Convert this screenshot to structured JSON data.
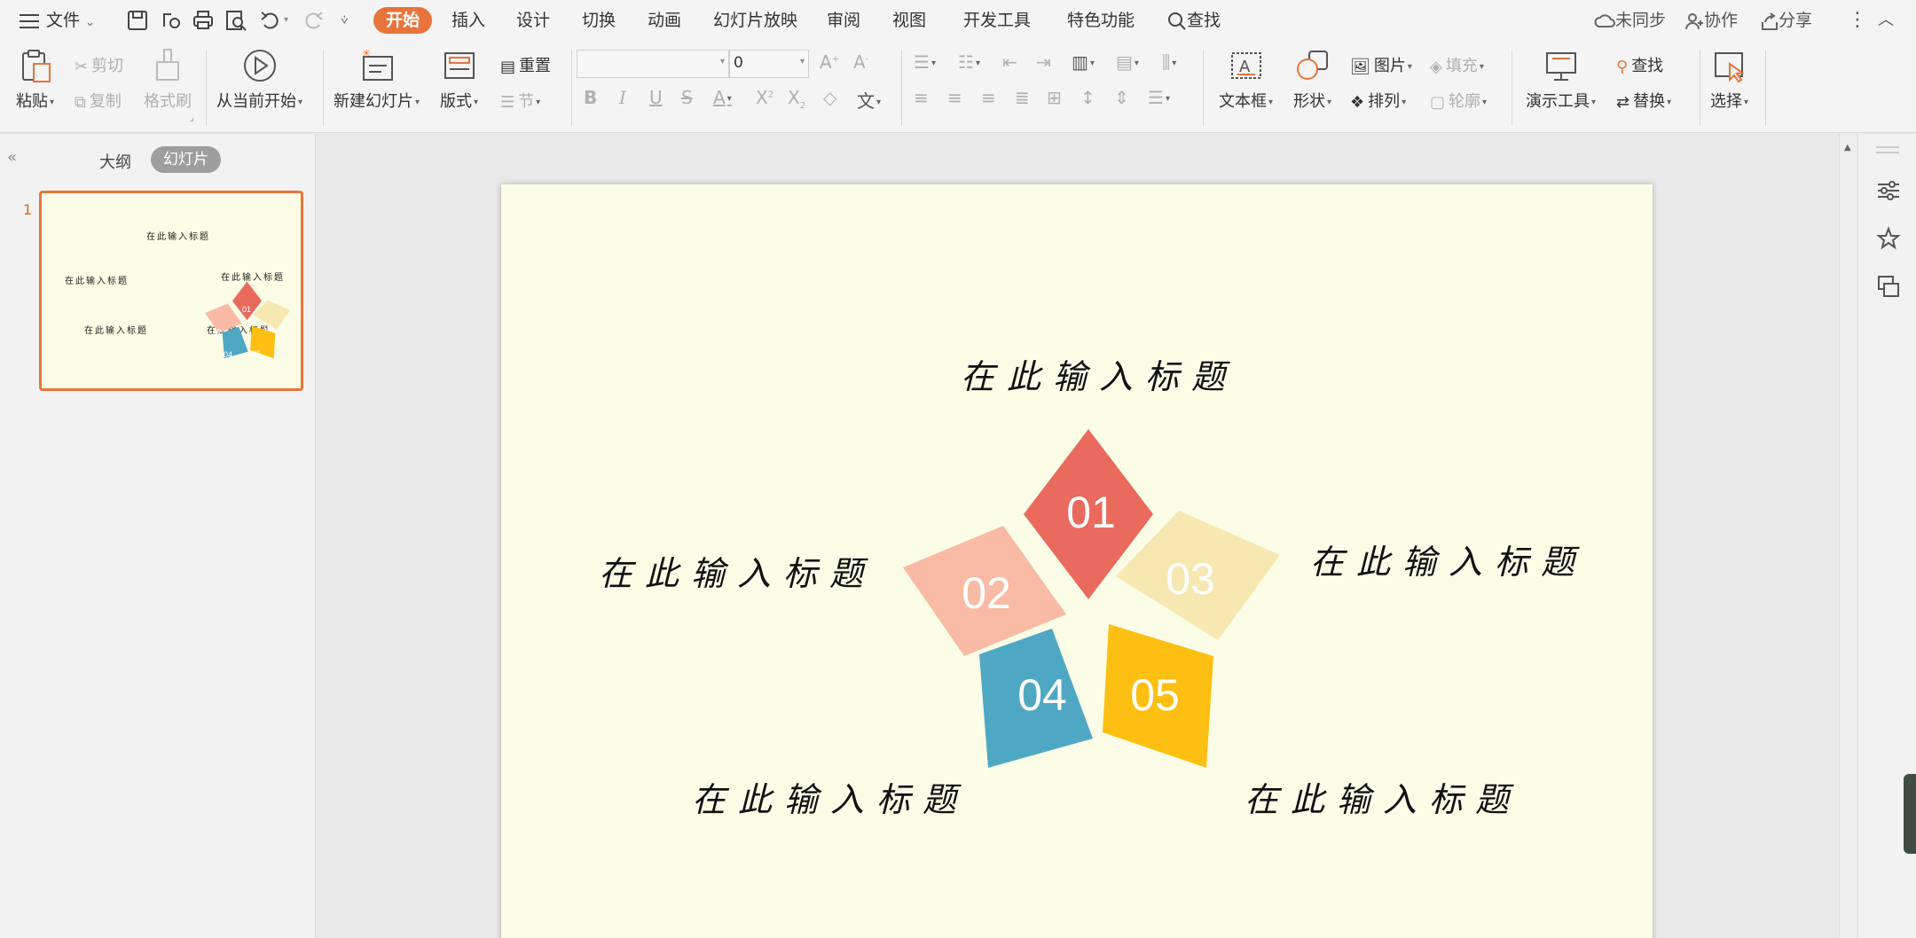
{
  "menubar": {
    "file_label": "文件",
    "tabs": [
      {
        "label": "开始",
        "active": true
      },
      {
        "label": "插入",
        "active": false
      },
      {
        "label": "设计",
        "active": false
      },
      {
        "label": "切换",
        "active": false
      },
      {
        "label": "动画",
        "active": false
      },
      {
        "label": "幻灯片放映",
        "active": false
      },
      {
        "label": "审阅",
        "active": false
      },
      {
        "label": "视图",
        "active": false
      },
      {
        "label": "开发工具",
        "active": false
      },
      {
        "label": "特色功能",
        "active": false
      }
    ],
    "search_label": "查找",
    "sync_label": "未同步",
    "collab_label": "协作",
    "share_label": "分享"
  },
  "ribbon": {
    "paste": "粘贴",
    "cut": "剪切",
    "copy": "复制",
    "format_painter": "格式刷",
    "play_from_current": "从当前开始",
    "new_slide": "新建幻灯片",
    "layout": "版式",
    "reset": "重置",
    "section": "节",
    "font_size_value": "0",
    "font_name_value": "",
    "textbox": "文本框",
    "shape": "形状",
    "picture": "图片",
    "fill": "填充",
    "arrange": "排列",
    "outline": "轮廓",
    "presenter_tools": "演示工具",
    "find": "查找",
    "replace": "替换",
    "select": "选择",
    "wen_char": "文"
  },
  "leftpanel": {
    "tab_outline": "大纲",
    "tab_slides": "幻灯片",
    "slide_number": "1"
  },
  "slide": {
    "title_top": "在此输入标题",
    "title_left": "在此输入标题",
    "title_right": "在此输入标题",
    "title_bottom_left": "在此输入标题",
    "title_bottom_right": "在此输入标题",
    "shapes": [
      {
        "label": "01",
        "color": "#ea6a5e"
      },
      {
        "label": "02",
        "color": "#f9bba5"
      },
      {
        "label": "03",
        "color": "#f7e8b2"
      },
      {
        "label": "04",
        "color": "#4fa8c3"
      },
      {
        "label": "05",
        "color": "#fdbf12"
      }
    ]
  },
  "colors": {
    "accent": "#e8743b",
    "slide_bg": "#fbfde6"
  }
}
